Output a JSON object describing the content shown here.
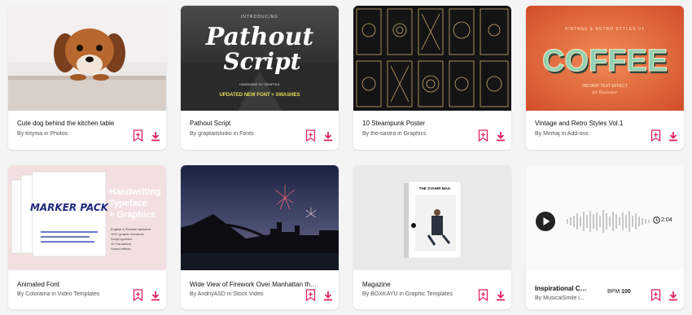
{
  "colors": {
    "accent": "#e0245e",
    "background": "#f4f4f4"
  },
  "cards": [
    {
      "title": "Cute dog behind the kitchen table",
      "by": "By fotyma in Photos"
    },
    {
      "title": "Pathout Script",
      "by": "By graptailstudio in Fonts",
      "art": {
        "intro": "INTRODUCING",
        "line1": "Pathout",
        "line2": "Script",
        "handmade": "HANDMADE BY GRAPTAIL",
        "updated": "UPDATED NEW FONT + SWASHES"
      }
    },
    {
      "title": "10 Steampunk Poster",
      "by": "By the-sastra in Graphics"
    },
    {
      "title": "Vintage and Retro Styles Vol.1",
      "by": "By Minhaj in Add-ons",
      "art": {
        "top": "VINTAGE & RETRO STYLES V1",
        "word": "COFFEE",
        "sub": "INSTANT TEXT EFFECT",
        "sub2": "for Illustrator"
      }
    },
    {
      "title": "Animated Font",
      "by": "By Colorama in Video Templates",
      "art": {
        "h1": "Handwriting",
        "h2": "Typeface",
        "h3": "+ Graphics",
        "box": "MARKER PACK",
        "bullets": [
          "English & Russian alphabet",
          "100+ graphic elements",
          "Script typeface",
          "10 Transitions",
          "Sound effects"
        ]
      }
    },
    {
      "title": "Wide View of Firework Over Manhattan the S...",
      "by": "By AndriyASD in Stock Video"
    },
    {
      "title": "Magazine",
      "by": "By BOXKAYU in Graphic Templates",
      "art": {
        "mag": "THE SYAHIR MAG"
      }
    },
    {
      "title": "Inspirational Ci...",
      "by": "By MusicalSmile i...",
      "bpm_label": "BPM",
      "bpm_value": "100",
      "duration": "2:04"
    }
  ]
}
